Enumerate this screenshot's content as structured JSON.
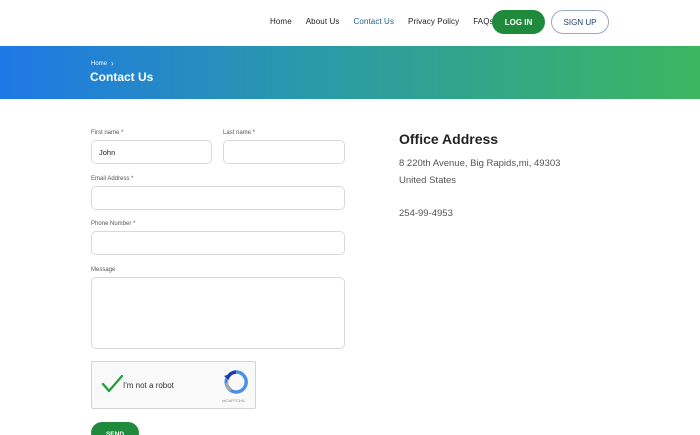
{
  "nav": {
    "links": [
      "Home",
      "About Us",
      "Contact Us",
      "Privacy Policy",
      "FAQs"
    ],
    "active": "Contact Us",
    "login_label": "LOG IN",
    "signup_label": "SIGN UP"
  },
  "banner": {
    "breadcrumb_home": "Home",
    "title": "Contact Us"
  },
  "form": {
    "first_name_label": "First name *",
    "first_name_value": "John",
    "last_name_label": "Last name *",
    "last_name_value": "",
    "email_label": "Email Address *",
    "email_value": "",
    "phone_label": "Phone Number *",
    "phone_value": "",
    "message_label": "Message",
    "message_value": "",
    "captcha_label": "I'm not a robot",
    "captcha_brand": "reCAPTCHA",
    "send_label": "SEND"
  },
  "office": {
    "title": "Office Address",
    "line1": "8 220th Avenue, Big Rapids,mi, 49303",
    "line2": "United States",
    "phone": "254-99-4953"
  },
  "colors": {
    "primary_green": "#1f8a3c",
    "banner_start": "#1f78e6",
    "banner_end": "#3cb65f",
    "active_link": "#1f5d8c"
  }
}
